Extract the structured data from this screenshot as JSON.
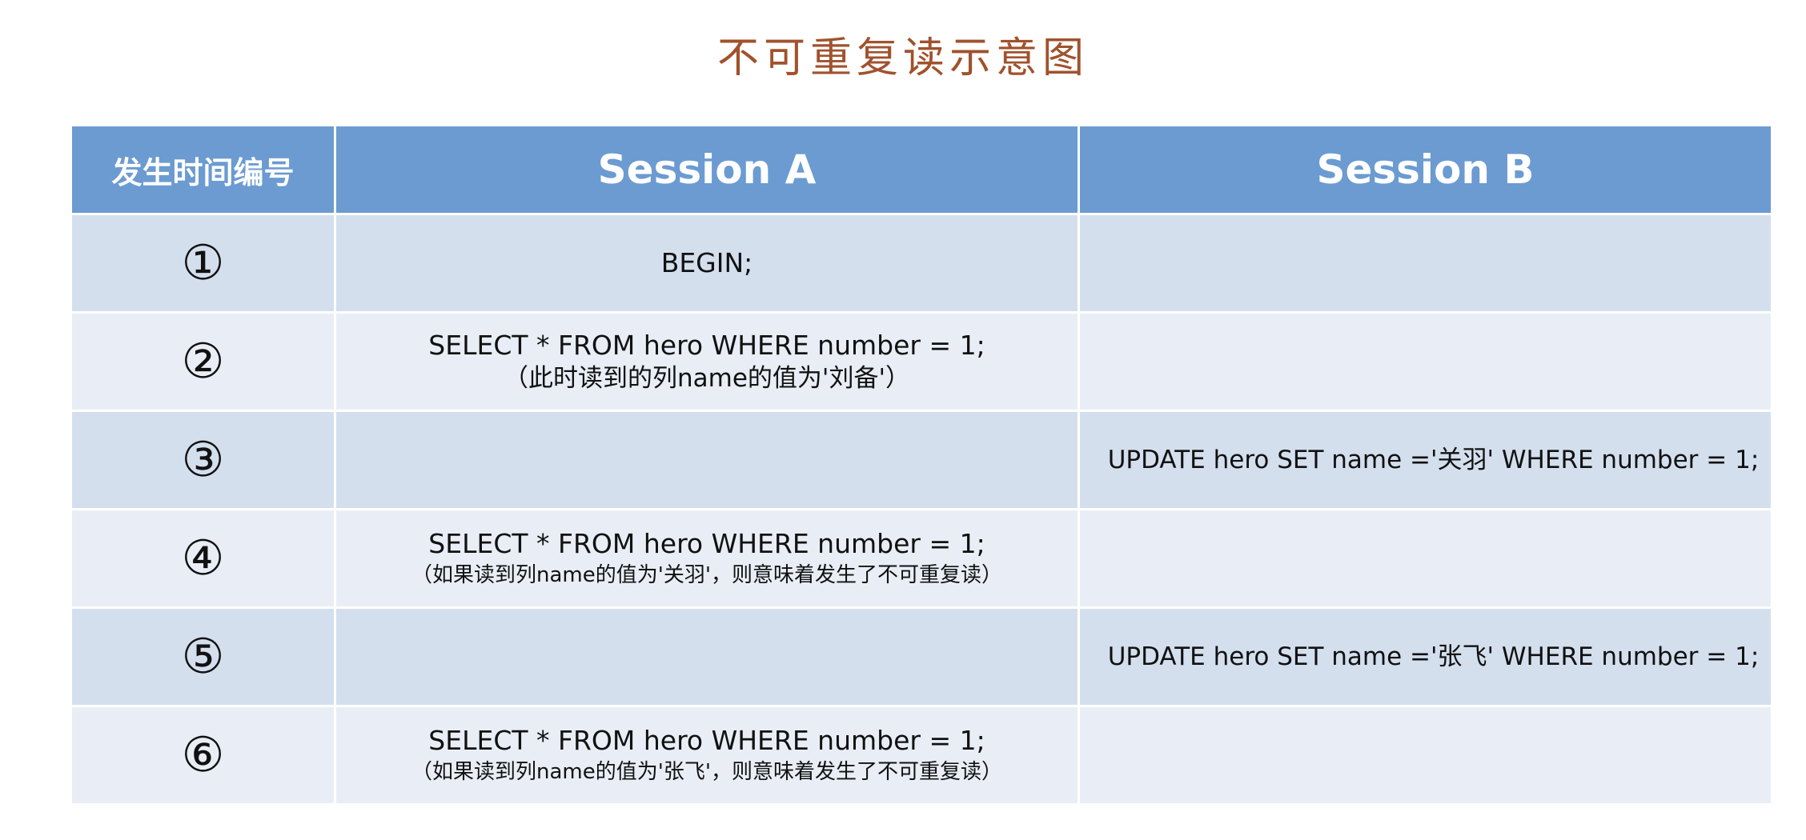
{
  "title": "不可重复读示意图",
  "header": {
    "seq": "发生时间编号",
    "session_a": "Session A",
    "session_b": "Session B"
  },
  "rows": [
    {
      "seq": "①",
      "a_stmt": "BEGIN;",
      "a_note": "",
      "b_stmt": ""
    },
    {
      "seq": "②",
      "a_stmt": "SELECT * FROM hero WHERE number = 1;",
      "a_note": "（此时读到的列name的值为'刘备'）",
      "b_stmt": ""
    },
    {
      "seq": "③",
      "a_stmt": "",
      "a_note": "",
      "b_stmt": "UPDATE hero SET name ='关羽' WHERE number = 1;"
    },
    {
      "seq": "④",
      "a_stmt": "SELECT * FROM hero WHERE number = 1;",
      "a_note": "（如果读到列name的值为'关羽'，则意味着发生了不可重复读）",
      "b_stmt": ""
    },
    {
      "seq": "⑤",
      "a_stmt": "",
      "a_note": "",
      "b_stmt": "UPDATE hero SET name ='张飞' WHERE number = 1;"
    },
    {
      "seq": "⑥",
      "a_stmt": "SELECT * FROM hero WHERE number = 1;",
      "a_note": "（如果读到列name的值为'张飞'，则意味着发生了不可重复读）",
      "b_stmt": ""
    }
  ],
  "colors": {
    "title": "#a0522d",
    "header_bg": "#6b9bd1",
    "row_odd_bg": "#d4dfee",
    "row_even_bg": "#e9eef6"
  }
}
